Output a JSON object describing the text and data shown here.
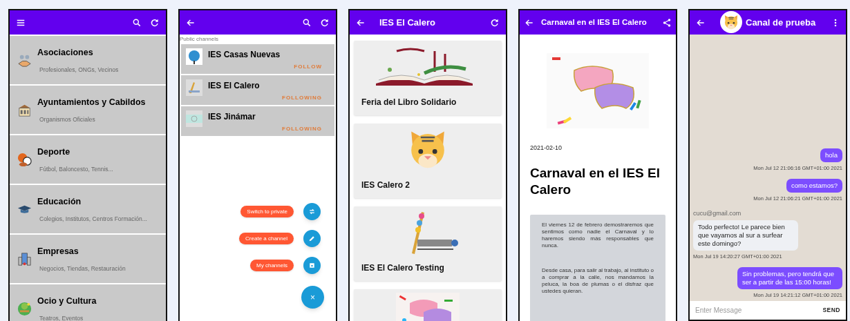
{
  "categories_screen": {
    "categories": [
      {
        "title": "Asociaciones",
        "subtitle": "Profesionales, ONGs, Vecinos"
      },
      {
        "title": "Ayuntamientos y Cabildos",
        "subtitle": "Organismos Oficiales"
      },
      {
        "title": "Deporte",
        "subtitle": "Fútbol, Baloncesto, Tennis..."
      },
      {
        "title": "Educación",
        "subtitle": "Colegios, Institutos, Centros Formación..."
      },
      {
        "title": "Empresas",
        "subtitle": "Negocios, Tiendas, Restauración"
      },
      {
        "title": "Ocio y Cultura",
        "subtitle": "Teatros, Eventos"
      }
    ]
  },
  "channels_screen": {
    "section_label": "Public channels",
    "channels": [
      {
        "name": "IES Casas Nuevas",
        "action": "FOLLOW"
      },
      {
        "name": "IES El Calero",
        "action": "FOLLOWING"
      },
      {
        "name": "IES Jinámar",
        "action": "FOLLOWING"
      }
    ],
    "fab_actions": [
      "Switch to private",
      "Create a channel",
      "My channels"
    ],
    "fab_close": "×"
  },
  "channel_screen": {
    "title": "IES El Calero",
    "posts": [
      {
        "title": "Feria del Libro Solidario"
      },
      {
        "title": "IES Calero 2"
      },
      {
        "title": "IES El Calero Testing"
      },
      {
        "kind": "picture"
      }
    ]
  },
  "article_screen": {
    "title": "Carnaval en el IES El Calero",
    "date": "2021-02-10",
    "heading": "Carnaval en el IES El Calero",
    "paragraphs": [
      "El viernes 12 de febrero demostraremos que sentimos como nadie el Carnaval y lo haremos siendo más responsables que nunca.",
      "Desde casa, para salir al trabajo, al instituto o a comprar a la calle, nos mandamos la peluca, la boa de plumas o el disfraz que ustedes quieran."
    ]
  },
  "chat_screen": {
    "title": "Canal de prueba",
    "messages": [
      {
        "kind": "outgoing",
        "text": "hola",
        "time": "Mon Jul 12 21:06:16 GMT+01:00 2021"
      },
      {
        "kind": "outgoing",
        "text": "como estamos?",
        "time": "Mon Jul 12 21:06:21 GMT+01:00 2021"
      },
      {
        "kind": "incoming",
        "author": "cucu@gmail.com",
        "text": "Todo perfecto! Le parece bien que vayamos al sur a surfear este domingo?",
        "time": "Mon Jul 19 14:20:27 GMT+01:00 2021"
      },
      {
        "kind": "outgoing",
        "text": "Sin problemas, pero tendrá que ser a partir de las 15:00 horas!",
        "time": "Mon Jul 19 14:21:12 GMT+01:00 2021"
      }
    ],
    "input": {
      "placeholder": "Enter Message"
    },
    "send_label": "SEND"
  }
}
